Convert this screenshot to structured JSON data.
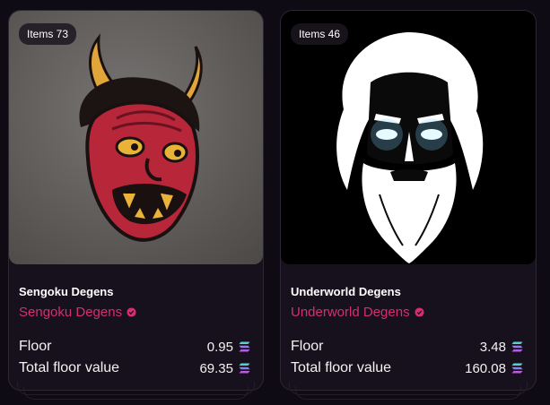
{
  "cards": [
    {
      "items_badge": "Items 73",
      "title": "Sengoku Degens",
      "collection_link": "Sengoku Degens",
      "floor_label": "Floor",
      "floor_value": "0.95",
      "total_label": "Total floor value",
      "total_value": "69.35"
    },
    {
      "items_badge": "Items 46",
      "title": "Underworld Degens",
      "collection_link": "Underworld Degens",
      "floor_label": "Floor",
      "floor_value": "3.48",
      "total_label": "Total floor value",
      "total_value": "160.08"
    }
  ],
  "colors": {
    "accent": "#d52e72",
    "card_bg": "#17111d",
    "page_bg": "#0f0b14"
  },
  "icons": [
    "verified-icon",
    "solana-icon"
  ]
}
